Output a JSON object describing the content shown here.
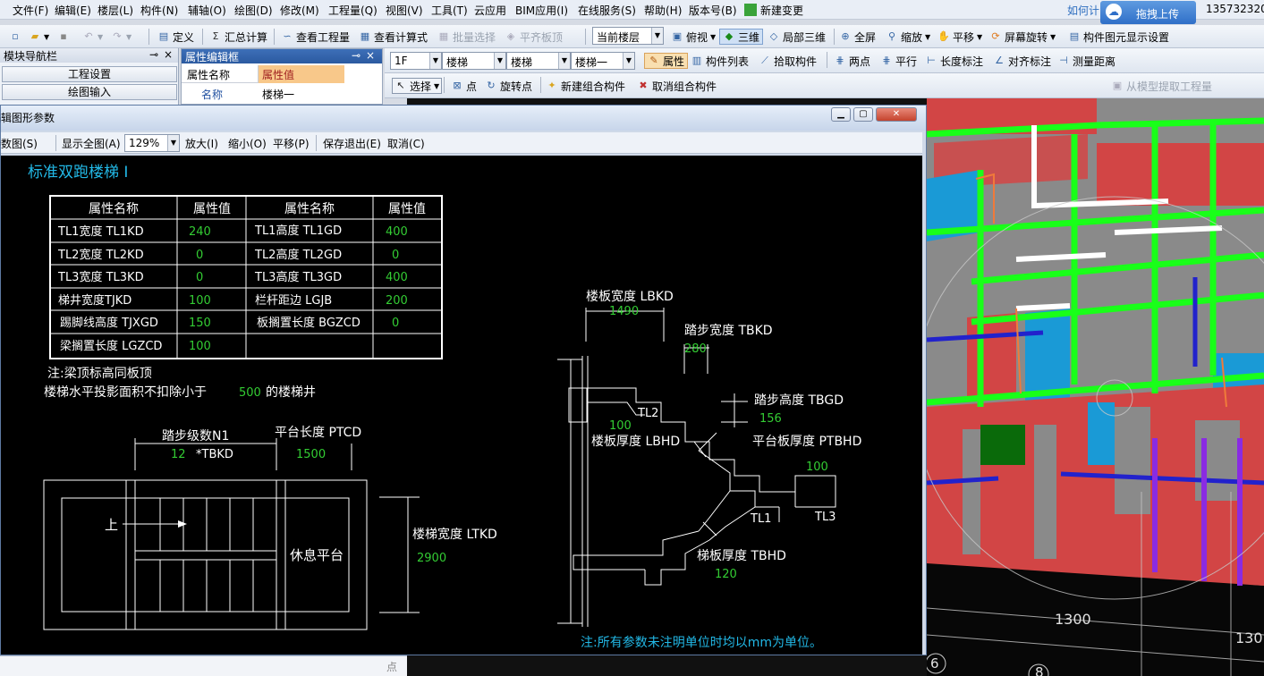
{
  "menubar": {
    "items": [
      "文件(F)",
      "编辑(E)",
      "楼层(L)",
      "构件(N)",
      "辅轴(O)",
      "绘图(D)",
      "修改(M)",
      "工程量(Q)",
      "视图(V)",
      "工具(T)",
      "云应用",
      "BIM应用(I)",
      "在线服务(S)",
      "帮助(H)",
      "版本号(B)",
      "新建变更"
    ],
    "help_link": "如何计",
    "upload_button": "拖拽上传",
    "account": "135732320"
  },
  "toolbar1": {
    "define": "定义",
    "summary_calc": "汇总计算",
    "view_quantity": "查看工程量",
    "view_formula": "查看计算式",
    "batch_select": "批量选择",
    "flat_slab_top": "平齐板顶",
    "floor_combo": "当前楼层",
    "top_view": "俯视",
    "three_d": "三维",
    "local_3d": "局部三维",
    "full_screen": "全屏",
    "zoom": "缩放",
    "pan": "平移",
    "screen_rotate": "屏幕旋转",
    "element_display_settings": "构件图元显示设置"
  },
  "toolbar2": {
    "floor": "1F",
    "category": "楼梯",
    "type": "楼梯",
    "element": "楼梯一",
    "properties": "属性",
    "element_list": "构件列表",
    "pick_element": "拾取构件",
    "two_points": "两点",
    "parallel": "平行",
    "length_dim": "长度标注",
    "angle_dim": "对齐标注",
    "measure_distance": "测量距离"
  },
  "toolbar3": {
    "select": "选择",
    "point": "点",
    "rotate_point": "旋转点",
    "new_group": "新建组合构件",
    "cancel_group": "取消组合构件",
    "extract_quantity": "从模型提取工程量"
  },
  "nav_panel": {
    "title": "模块导航栏",
    "pin": "ᴘ",
    "close": "×",
    "items": [
      "工程设置",
      "绘图输入"
    ]
  },
  "prop_panel": {
    "title": "属性编辑框",
    "header_name": "属性名称",
    "header_value": "属性值",
    "row_name": "名称",
    "row_value": "楼梯一"
  },
  "dialog": {
    "title": "编辑图形参数",
    "tools": {
      "select_params": "参数图(S)",
      "show_all": "显示全图(A)",
      "zoom_value": "129%",
      "zoom_in": "放大(I)",
      "zoom_out": "缩小(O)",
      "pan": "平移(P)",
      "save_exit": "保存退出(E)",
      "cancel": "取消(C)"
    }
  },
  "drawing": {
    "title": "标准双跑楼梯 I",
    "table": {
      "headers": [
        "属性名称",
        "属性值",
        "属性名称",
        "属性值"
      ],
      "rows": [
        [
          "TL1宽度 TL1KD",
          "240",
          "TL1高度 TL1GD",
          "400"
        ],
        [
          "TL2宽度 TL2KD",
          "0",
          "TL2高度 TL2GD",
          "0"
        ],
        [
          "TL3宽度 TL3KD",
          "0",
          "TL3高度 TL3GD",
          "400"
        ],
        [
          "梯井宽度TJKD",
          "100",
          "栏杆距边 LGJB",
          "200"
        ],
        [
          "踢脚线高度 TJXGD",
          "150",
          "板搁置长度 BGZCD",
          "0"
        ],
        [
          "梁搁置长度 LGZCD",
          "100",
          "",
          ""
        ]
      ]
    },
    "note1": "注:梁顶标高同板顶",
    "note2_prefix": "楼梯水平投影面积不扣除小于",
    "note2_value": "500",
    "note2_suffix": "的楼梯井",
    "plan": {
      "steps_label": "踏步级数N1",
      "steps_value": "12",
      "steps_suffix": "*TBKD",
      "landing_label": "平台长度 PTCD",
      "landing_value": "1500",
      "up": "上",
      "rest_platform": "休息平台",
      "width_label": "楼梯宽度 LTKD",
      "width_value": "2900"
    },
    "section": {
      "slab_width_label": "楼板宽度 LBKD",
      "slab_width_value": "1490",
      "tread_width_label": "踏步宽度 TBKD",
      "tread_width_value": "280",
      "riser_label": "踏步高度 TBGD",
      "riser_value": "156",
      "slab_thk_label": "楼板厚度 LBHD",
      "slab_thk_value": "100",
      "tl2": "TL2",
      "landing_thk_label": "平台板厚度 PTBHD",
      "landing_thk_value": "100",
      "tl1": "TL1",
      "tl3": "TL3",
      "stair_thk_label": "梯板厚度 TBHD",
      "stair_thk_value": "120"
    },
    "footer_note": "注:所有参数未注明单位时均以mm为单位。"
  },
  "view3d": {
    "dim1": "1300",
    "dim2": "130",
    "axis1": "6",
    "axis2": "8"
  },
  "colors": {
    "cad_bg": "#000000",
    "cad_line": "#ffffff",
    "cad_value": "#33cc33",
    "cad_title": "#22b8e6",
    "beam_green": "#19ff19",
    "slab_red": "#d24545",
    "stair_blue": "#1a9ad6"
  }
}
